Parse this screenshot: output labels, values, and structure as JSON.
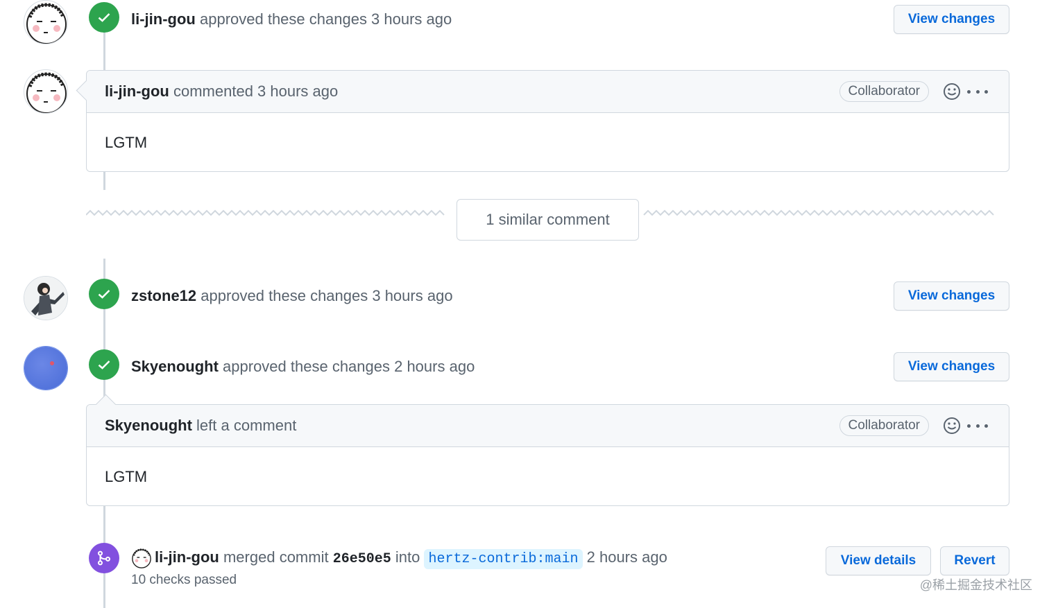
{
  "timeline": {
    "events": [
      {
        "author": "li-jin-gou",
        "action": "approved these changes 3 hours ago",
        "button": "View changes"
      },
      {
        "author": "zstone12",
        "action": "approved these changes 3 hours ago",
        "button": "View changes"
      },
      {
        "author": "Skyenought",
        "action": "approved these changes 2 hours ago",
        "button": "View changes"
      }
    ],
    "comments": [
      {
        "author": "li-jin-gou",
        "action": "commented 3 hours ago",
        "label": "Collaborator",
        "body": "LGTM"
      },
      {
        "author": "Skyenought",
        "action": "left a comment",
        "label": "Collaborator",
        "body": "LGTM"
      }
    ],
    "similar_comment": "1 similar comment",
    "merge": {
      "author": "li-jin-gou",
      "verb": "merged commit",
      "sha": "26e50e5",
      "into": "into",
      "branch": "hertz-contrib:main",
      "time": "2 hours ago",
      "checks": "10 checks passed",
      "view_details": "View details",
      "revert": "Revert"
    }
  },
  "watermark": "@稀土掘金技术社区",
  "colors": {
    "success": "#2da44e",
    "merged": "#8250df",
    "link": "#0969da",
    "border": "#d0d7de"
  },
  "icons": {
    "approved": "check-icon",
    "merged": "git-merge-icon",
    "reaction": "smiley-icon",
    "menu": "kebab-horizontal-icon"
  }
}
